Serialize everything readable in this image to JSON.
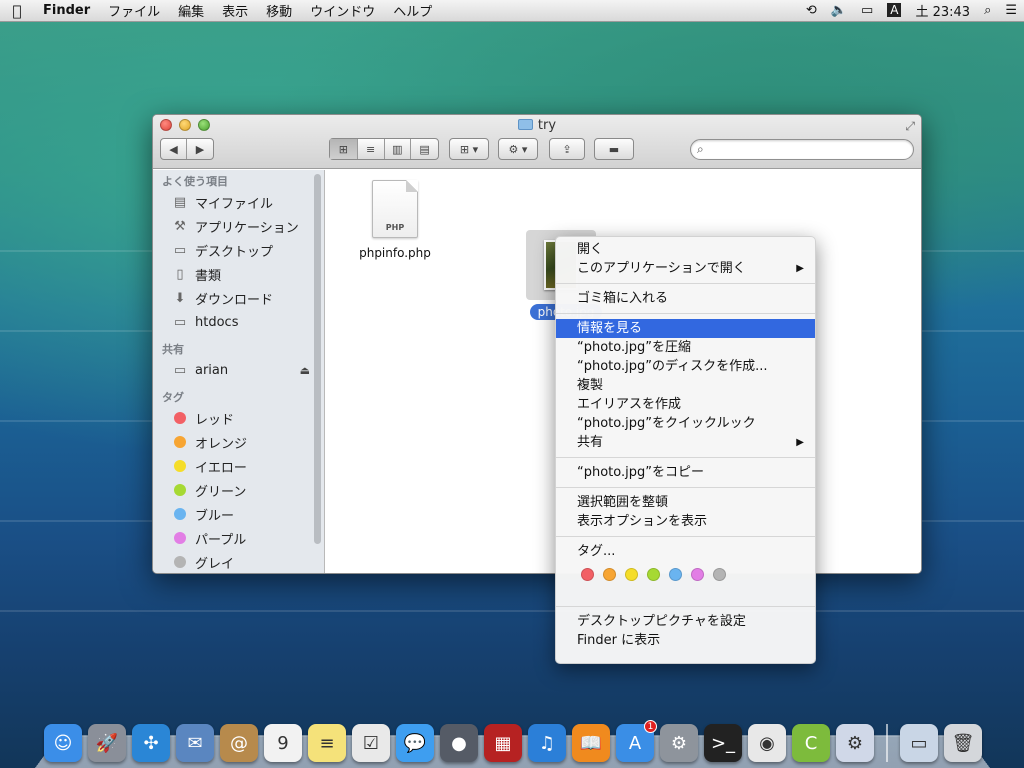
{
  "menubar": {
    "apple": "",
    "app": "Finder",
    "items": [
      "ファイル",
      "編集",
      "表示",
      "移動",
      "ウインドウ",
      "ヘルプ"
    ],
    "input_indicator": "A",
    "clock": "土 23:43"
  },
  "window": {
    "title": "try",
    "search_placeholder": ""
  },
  "sidebar": {
    "favorites_header": "よく使う項目",
    "favorites": [
      {
        "label": "マイファイル",
        "icon": "all-files-icon"
      },
      {
        "label": "アプリケーション",
        "icon": "applications-icon"
      },
      {
        "label": "デスクトップ",
        "icon": "desktop-icon"
      },
      {
        "label": "書類",
        "icon": "documents-icon"
      },
      {
        "label": "ダウンロード",
        "icon": "downloads-icon"
      },
      {
        "label": "htdocs",
        "icon": "folder-icon"
      }
    ],
    "shared_header": "共有",
    "shared": [
      {
        "label": "arian",
        "icon": "computer-icon"
      }
    ],
    "tags_header": "タグ",
    "tags": [
      {
        "label": "レッド",
        "color": "#f26065"
      },
      {
        "label": "オレンジ",
        "color": "#f7a533"
      },
      {
        "label": "イエロー",
        "color": "#f5dd29"
      },
      {
        "label": "グリーン",
        "color": "#a6d933"
      },
      {
        "label": "ブルー",
        "color": "#6ab4f0"
      },
      {
        "label": "パープル",
        "color": "#e27ee5"
      },
      {
        "label": "グレイ",
        "color": "#b4b4b4"
      }
    ]
  },
  "files": [
    {
      "name": "phpinfo.php",
      "type_label": "PHP"
    },
    {
      "name": "photo.jpg"
    }
  ],
  "context_menu": {
    "open": "開く",
    "open_with": "このアプリケーションで開く",
    "trash": "ゴミ箱に入れる",
    "get_info": "情報を見る",
    "compress": "“photo.jpg”を圧縮",
    "burn": "“photo.jpg”のディスクを作成...",
    "duplicate": "複製",
    "alias": "エイリアスを作成",
    "quicklook": "“photo.jpg”をクイックルック",
    "share": "共有",
    "copy": "“photo.jpg”をコピー",
    "clean_up": "選択範囲を整頓",
    "view_options": "表示オプションを表示",
    "tags": "タグ...",
    "tag_colors": [
      "#f26065",
      "#f7a533",
      "#f5dd29",
      "#a6d933",
      "#6ab4f0",
      "#e27ee5",
      "#b4b4b4"
    ],
    "set_desktop": "デスクトップピクチャを設定",
    "show_in_finder": "Finder に表示"
  },
  "dock": {
    "apps": [
      {
        "name": "finder-icon",
        "color": "#3b8ee8",
        "glyph": "☺"
      },
      {
        "name": "launchpad-icon",
        "color": "#8a8f99",
        "glyph": "🚀"
      },
      {
        "name": "safari-icon",
        "color": "#2a86d6",
        "glyph": "✣"
      },
      {
        "name": "mail-icon",
        "color": "#5a86c0",
        "glyph": "✉"
      },
      {
        "name": "contacts-icon",
        "color": "#b78a4c",
        "glyph": "@"
      },
      {
        "name": "calendar-icon",
        "color": "#f2f2f2",
        "glyph": "9"
      },
      {
        "name": "notes-icon",
        "color": "#f5e27a",
        "glyph": "≡"
      },
      {
        "name": "reminders-icon",
        "color": "#e9e9e9",
        "glyph": "☑"
      },
      {
        "name": "messages-icon",
        "color": "#3e9ef0",
        "glyph": "💬"
      },
      {
        "name": "facetime-icon",
        "color": "#555b66",
        "glyph": "●"
      },
      {
        "name": "photobooth-icon",
        "color": "#b62222",
        "glyph": "▦"
      },
      {
        "name": "itunes-icon",
        "color": "#2b7fd8",
        "glyph": "♫"
      },
      {
        "name": "ibooks-icon",
        "color": "#f08a1e",
        "glyph": "📖"
      },
      {
        "name": "appstore-icon",
        "color": "#3a8ee6",
        "glyph": "A",
        "badge": "1"
      },
      {
        "name": "system-preferences-icon",
        "color": "#8e949c",
        "glyph": "⚙"
      },
      {
        "name": "terminal-icon",
        "color": "#222",
        "glyph": ">_"
      },
      {
        "name": "chrome-icon",
        "color": "#e8e8e8",
        "glyph": "◉"
      },
      {
        "name": "coda-icon",
        "color": "#7dbb3c",
        "glyph": "C"
      },
      {
        "name": "utility-icon",
        "color": "#d0d8e8",
        "glyph": "⚙"
      }
    ],
    "right": [
      {
        "name": "desktop-folder-icon",
        "color": "#c9d6e6",
        "glyph": "▭"
      },
      {
        "name": "trash-icon",
        "color": "#d4d7db",
        "glyph": "🗑"
      }
    ]
  }
}
